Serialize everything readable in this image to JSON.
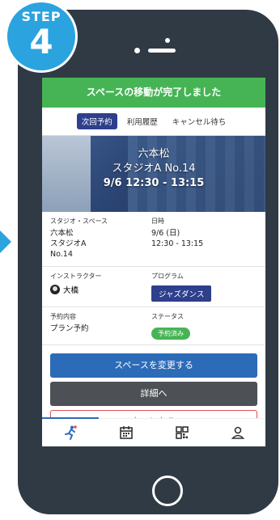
{
  "step": {
    "label": "STEP",
    "number": "4"
  },
  "banner": {
    "text": "スペースの移動が完了しました"
  },
  "tabs": [
    {
      "label": "次回予約",
      "active": true
    },
    {
      "label": "利用履歴",
      "active": false
    },
    {
      "label": "キャンセル待ち",
      "active": false
    }
  ],
  "hero": {
    "location": "六本松",
    "studio": "スタジオA No.14",
    "datetime": "9/6 12:30 - 13:15"
  },
  "details": {
    "studio_space_label": "スタジオ・スペース",
    "studio_space_lines": [
      "六本松",
      "スタジオA",
      "No.14"
    ],
    "date_label": "日時",
    "date_value": "9/6 (日)",
    "time_value": "12:30 - 13:15",
    "instructor_label": "インストラクター",
    "instructor_name": "大橋",
    "program_label": "プログラム",
    "program_value": "ジャズダンス",
    "reservation_label": "予約内容",
    "reservation_value": "プラン予約",
    "status_label": "ステータス",
    "status_value": "予約済み"
  },
  "buttons": {
    "change_space": "スペースを変更する",
    "details": "詳細へ",
    "cancel": "キャンセル"
  },
  "colors": {
    "accent_blue": "#2aa3df",
    "banner_green": "#46b455",
    "navy": "#2e3f8c",
    "primary_button": "#2c6bb8",
    "phone_body": "#2f3a44"
  },
  "nav_icons": [
    "runner-icon",
    "calendar-icon",
    "qr-code-icon",
    "user-icon"
  ]
}
